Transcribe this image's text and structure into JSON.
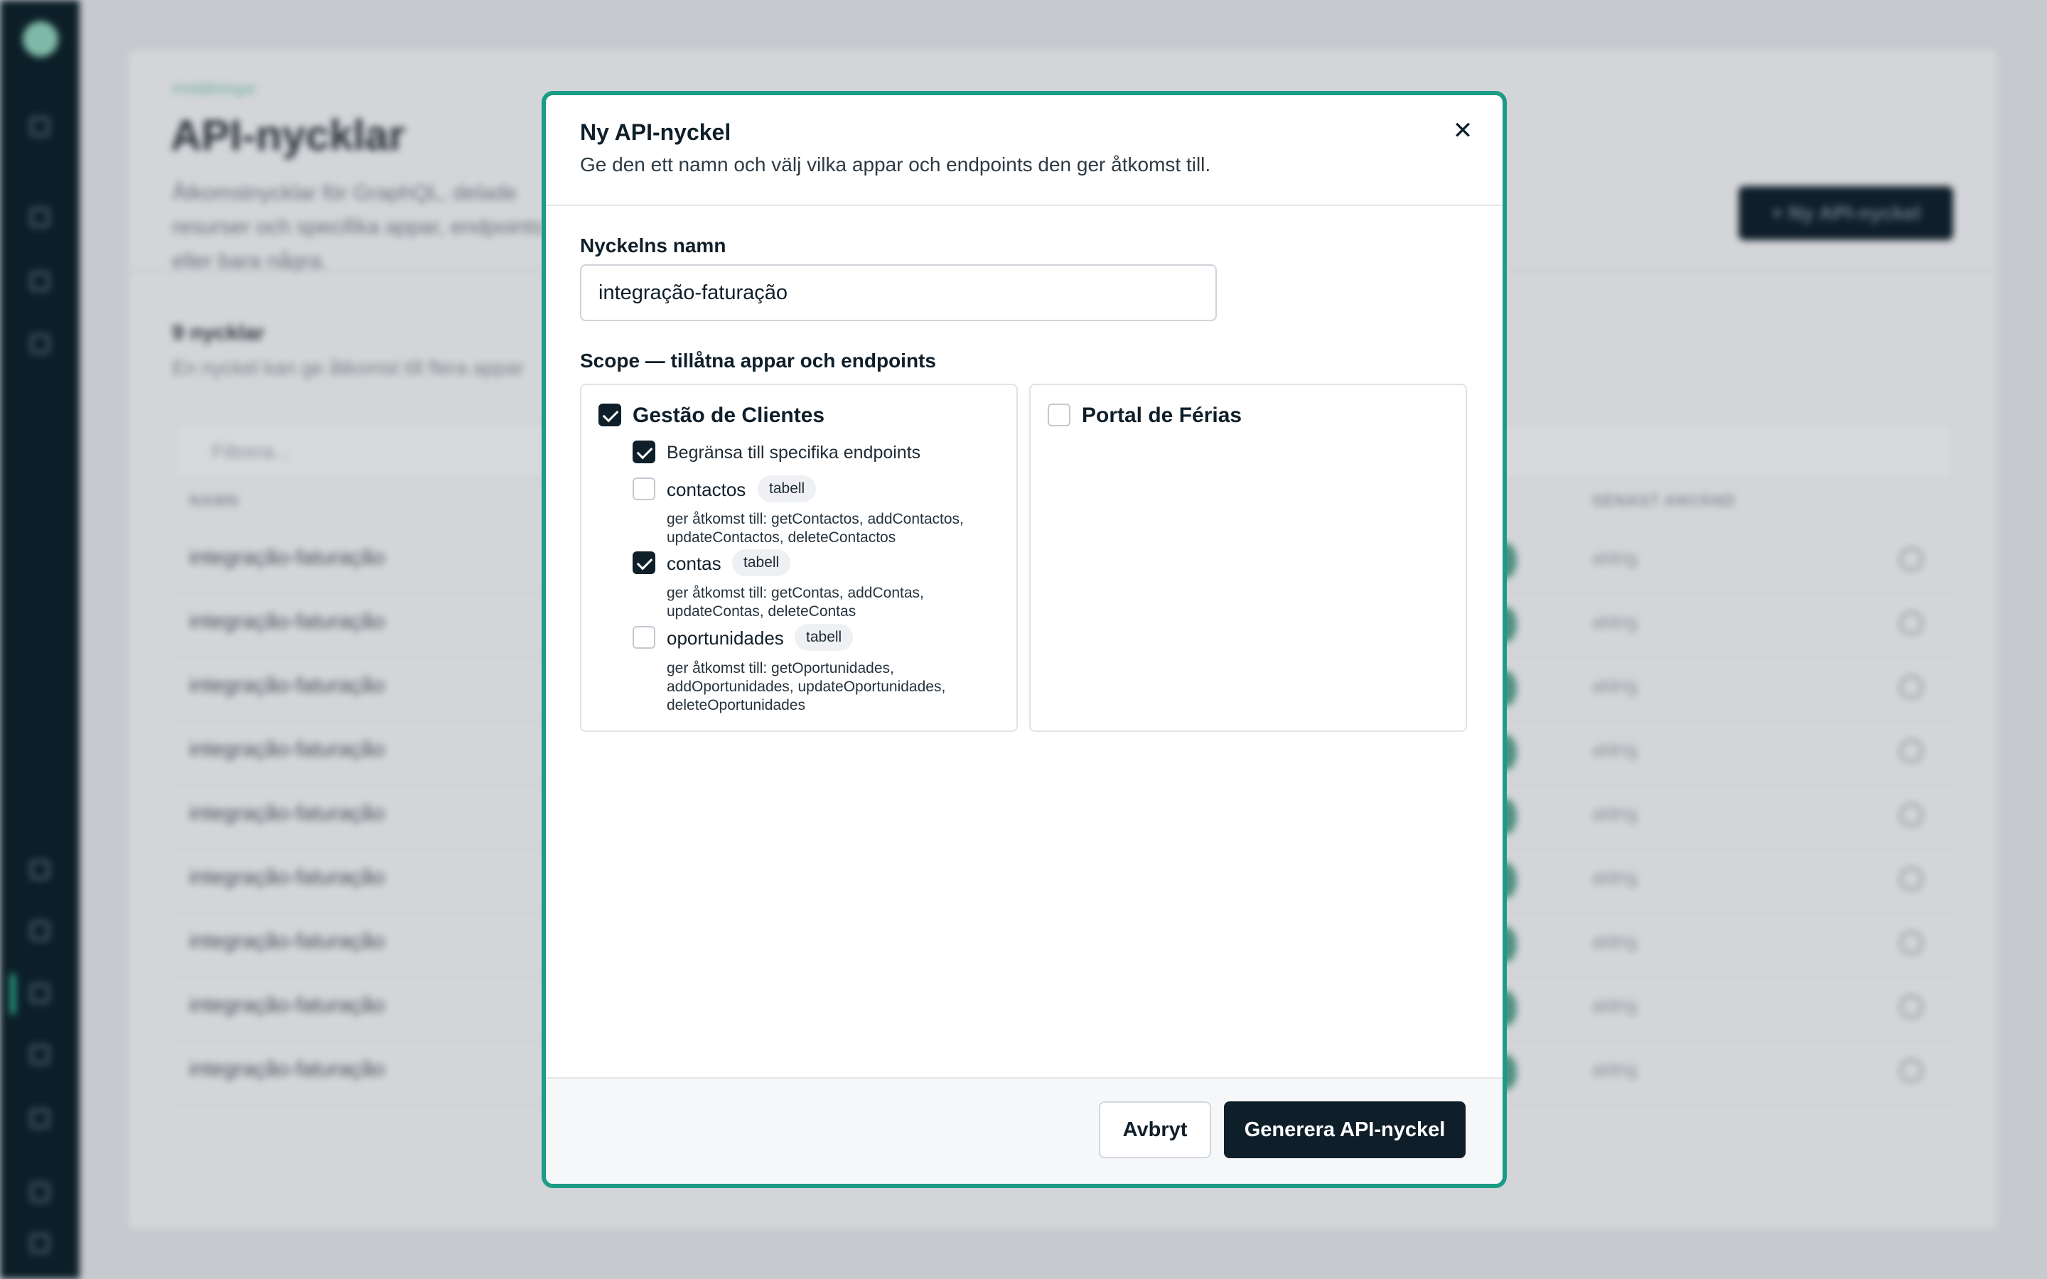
{
  "background": {
    "breadcrumb": "Inställningar",
    "page_title": "API-nycklar",
    "page_description": "Åtkomstnycklar för GraphQL, delade resurser och specifika appar, endpoints eller bara några.",
    "new_key_button": "+  Ny API-nyckel",
    "count_title": "9 nycklar",
    "count_subtitle": "En nyckel kan ge åtkomst till flera appar",
    "filter_placeholder": "Filtrera...",
    "column_name": "NAMN",
    "column_last_used": "SENAST ANVÄND",
    "rows": [
      {
        "name": "integração-faturação",
        "status": "aldrig"
      },
      {
        "name": "integração-faturação",
        "status": "aldrig"
      },
      {
        "name": "integração-faturação",
        "status": "aldrig"
      },
      {
        "name": "integração-faturação",
        "status": "aldrig"
      },
      {
        "name": "integração-faturação",
        "status": "aldrig"
      },
      {
        "name": "integração-faturação",
        "status": "aldrig"
      },
      {
        "name": "integração-faturação",
        "status": "aldrig"
      },
      {
        "name": "integração-faturação",
        "status": "aldrig"
      },
      {
        "name": "integração-faturação",
        "status": "aldrig"
      }
    ]
  },
  "modal": {
    "title": "Ny API-nyckel",
    "subtitle": "Ge den ett namn och välj vilka appar och endpoints den ger åtkomst till.",
    "close_icon": "close-icon",
    "name_label": "Nyckelns namn",
    "name_value": "integração-faturação",
    "scope_label": "Scope — tillåtna appar och endpoints",
    "apps": [
      {
        "name": "Gestão de Clientes",
        "checked": true,
        "restrict_label": "Begränsa till specifika endpoints",
        "restrict_checked": true,
        "endpoints": [
          {
            "name": "contactos",
            "badge": "tabell",
            "checked": false,
            "description": "ger åtkomst till: getContactos, addContactos, updateContactos, deleteContactos"
          },
          {
            "name": "contas",
            "badge": "tabell",
            "checked": true,
            "description": "ger åtkomst till: getContas, addContas, updateContas, deleteContas"
          },
          {
            "name": "oportunidades",
            "badge": "tabell",
            "checked": false,
            "description": "ger åtkomst till: getOportunidades, addOportunidades, updateOportunidades, deleteOportunidades"
          }
        ]
      },
      {
        "name": "Portal de Férias",
        "checked": false
      }
    ],
    "cancel_label": "Avbryt",
    "generate_label": "Generera API-nyckel"
  },
  "colors": {
    "accent_border": "#1c9b86",
    "primary_button": "#0f1f2a",
    "sidebar": "#0c1f28"
  }
}
